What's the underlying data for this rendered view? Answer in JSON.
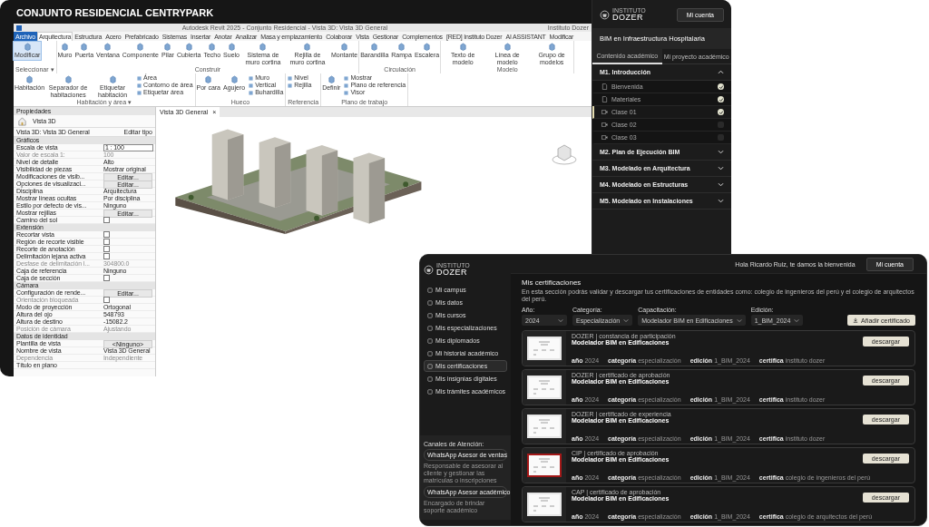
{
  "back_window": {
    "title": "CONJUNTO RESIDENCIAL CENTRYPARK",
    "revit": {
      "window_title": "Autodesk Revit 2025 - Conjunto Residencial - Vista 3D: Vista 3D General",
      "user": "Instituto Dozer",
      "tabs": [
        {
          "label": "Archivo",
          "kind": "file",
          "selected": false
        },
        {
          "label": "Arquitectura",
          "kind": "tab",
          "selected": true
        },
        {
          "label": "Estructura",
          "kind": "tab",
          "selected": false
        },
        {
          "label": "Acero",
          "kind": "tab",
          "selected": false
        },
        {
          "label": "Prefabricado",
          "kind": "tab",
          "selected": false
        },
        {
          "label": "Sistemas",
          "kind": "tab",
          "selected": false
        },
        {
          "label": "Insertar",
          "kind": "tab",
          "selected": false
        },
        {
          "label": "Anotar",
          "kind": "tab",
          "selected": false
        },
        {
          "label": "Analizar",
          "kind": "tab",
          "selected": false
        },
        {
          "label": "Masa y emplazamiento",
          "kind": "tab",
          "selected": false
        },
        {
          "label": "Colaborar",
          "kind": "tab",
          "selected": false
        },
        {
          "label": "Vista",
          "kind": "tab",
          "selected": false
        },
        {
          "label": "Gestionar",
          "kind": "tab",
          "selected": false
        },
        {
          "label": "Complementos",
          "kind": "tab",
          "selected": false
        },
        {
          "label": "[RED] Instituto Dozer",
          "kind": "tab",
          "selected": false
        },
        {
          "label": "AI ASSISTANT",
          "kind": "tab",
          "selected": false
        },
        {
          "label": "Modificar",
          "kind": "tab",
          "selected": false
        }
      ],
      "groups": [
        {
          "label": "Seleccionar ▾",
          "tools": [
            {
              "label": "Modificar",
              "kind": "large",
              "selected": true
            }
          ]
        },
        {
          "label": "Construir",
          "tools": [
            {
              "label": "Muro",
              "kind": "large",
              "selected": false
            },
            {
              "label": "Puerta",
              "kind": "large",
              "selected": false
            },
            {
              "label": "Ventana",
              "kind": "large",
              "selected": false
            },
            {
              "label": "Componente",
              "kind": "large",
              "selected": false
            },
            {
              "label": "Pilar",
              "kind": "large",
              "selected": false
            },
            {
              "label": "Cubierta",
              "kind": "large",
              "selected": false
            },
            {
              "label": "Techo",
              "kind": "large",
              "selected": false
            },
            {
              "label": "Suelo",
              "kind": "large",
              "selected": false
            },
            {
              "label": "Sistema de muro cortina",
              "kind": "large",
              "selected": false
            },
            {
              "label": "Rejilla de muro cortina",
              "kind": "large",
              "selected": false
            },
            {
              "label": "Montante",
              "kind": "large",
              "selected": false
            }
          ]
        },
        {
          "label": "Circulación",
          "tools": [
            {
              "label": "Barandilla",
              "kind": "large",
              "selected": false
            },
            {
              "label": "Rampa",
              "kind": "large",
              "selected": false
            },
            {
              "label": "Escalera",
              "kind": "large",
              "selected": false
            }
          ]
        },
        {
          "label": "Modelo",
          "tools": [
            {
              "label": "Texto de modelo",
              "kind": "large",
              "selected": false
            },
            {
              "label": "Línea de modelo",
              "kind": "large",
              "selected": false
            },
            {
              "label": "Grupo de modelos",
              "kind": "large",
              "selected": false
            }
          ]
        },
        {
          "label": "Habitación y área ▾",
          "tools": [
            {
              "label": "Habitación",
              "kind": "large",
              "selected": false
            },
            {
              "label": "Separador de habitaciones",
              "kind": "large",
              "selected": false
            },
            {
              "label": "Etiquetar habitación",
              "kind": "large",
              "selected": false
            },
            {
              "label": "Área",
              "kind": "small",
              "selected": false
            },
            {
              "label": "Contorno de área",
              "kind": "small",
              "selected": false
            },
            {
              "label": "Etiquetar área",
              "kind": "small",
              "selected": false
            }
          ]
        },
        {
          "label": "Hueco",
          "tools": [
            {
              "label": "Por cara",
              "kind": "large",
              "selected": false
            },
            {
              "label": "Agujero",
              "kind": "large",
              "selected": false
            },
            {
              "label": "Muro",
              "kind": "small",
              "selected": false
            },
            {
              "label": "Vertical",
              "kind": "small",
              "selected": false
            },
            {
              "label": "Buhardilla",
              "kind": "small",
              "selected": false
            }
          ]
        },
        {
          "label": "Referencia",
          "tools": [
            {
              "label": "Nivel",
              "kind": "small",
              "selected": false
            },
            {
              "label": "Rejilla",
              "kind": "small",
              "selected": false
            }
          ]
        },
        {
          "label": "Plano de trabajo",
          "tools": [
            {
              "label": "Definir",
              "kind": "large",
              "selected": false
            },
            {
              "label": "Mostrar",
              "kind": "small",
              "selected": false
            },
            {
              "label": "Plano de referencia",
              "kind": "small",
              "selected": false
            },
            {
              "label": "Visor",
              "kind": "small",
              "selected": false
            }
          ]
        }
      ],
      "properties": {
        "title": "Propiedades",
        "type": "Vista 3D",
        "view_selector": "Vista 3D: Vista 3D General",
        "edit_type": "Editar tipo",
        "sections": [
          {
            "title": "Gráficos",
            "rows": [
              {
                "label": "Escala de vista",
                "kind": "field",
                "value": "1 : 100",
                "disabled": false
              },
              {
                "label": "Valor de escala 1:",
                "kind": "text",
                "value": "100",
                "disabled": true
              },
              {
                "label": "Nivel de detalle",
                "kind": "text",
                "value": "Alto",
                "disabled": false
              },
              {
                "label": "Visibilidad de piezas",
                "kind": "text",
                "value": "Mostrar original",
                "disabled": false
              },
              {
                "label": "Modificaciones de visib...",
                "kind": "button",
                "value": "Editar...",
                "disabled": false
              },
              {
                "label": "Opciones de visualizaci...",
                "kind": "button",
                "value": "Editar...",
                "disabled": false
              },
              {
                "label": "Disciplina",
                "kind": "text",
                "value": "Arquitectura",
                "disabled": false
              },
              {
                "label": "Mostrar líneas ocultas",
                "kind": "text",
                "value": "Por disciplina",
                "disabled": false
              },
              {
                "label": "Estilo por defecto de vis...",
                "kind": "text",
                "value": "Ninguno",
                "disabled": false
              },
              {
                "label": "Mostrar rejillas",
                "kind": "button",
                "value": "Editar...",
                "disabled": false
              },
              {
                "label": "Camino del sol",
                "kind": "check",
                "checked": false,
                "disabled": false
              }
            ]
          },
          {
            "title": "Extensión",
            "rows": [
              {
                "label": "Recortar vista",
                "kind": "check",
                "checked": false,
                "disabled": false
              },
              {
                "label": "Región de recorte visible",
                "kind": "check",
                "checked": false,
                "disabled": false
              },
              {
                "label": "Recorte de anotación",
                "kind": "check",
                "checked": false,
                "disabled": false
              },
              {
                "label": "Delimitación lejana activa",
                "kind": "check",
                "checked": false,
                "disabled": false
              },
              {
                "label": "Desfase de delimitación l...",
                "kind": "text",
                "value": "304800.0",
                "disabled": true
              },
              {
                "label": "Caja de referencia",
                "kind": "text",
                "value": "Ninguno",
                "disabled": false
              },
              {
                "label": "Caja de sección",
                "kind": "check",
                "checked": false,
                "disabled": false
              }
            ]
          },
          {
            "title": "Cámara",
            "rows": [
              {
                "label": "Configuración de rende...",
                "kind": "button",
                "value": "Editar...",
                "disabled": false
              },
              {
                "label": "Orientación bloqueada",
                "kind": "check",
                "checked": false,
                "disabled": true
              },
              {
                "label": "Modo de proyección",
                "kind": "text",
                "value": "Ortogonal",
                "disabled": false
              },
              {
                "label": "Altura del ojo",
                "kind": "text",
                "value": "548793",
                "disabled": false
              },
              {
                "label": "Altura de destino",
                "kind": "text",
                "value": "-15082.2",
                "disabled": false
              },
              {
                "label": "Posición de cámara",
                "kind": "text",
                "value": "Ajustando",
                "disabled": true
              }
            ]
          },
          {
            "title": "Datos de identidad",
            "rows": [
              {
                "label": "Plantilla de vista",
                "kind": "button",
                "value": "<Ninguno>",
                "disabled": false
              },
              {
                "label": "Nombre de vista",
                "kind": "text",
                "value": "Vista 3D General",
                "disabled": false
              },
              {
                "label": "Dependencia",
                "kind": "text",
                "value": "Independiente",
                "disabled": true
              },
              {
                "label": "Título en plano",
                "kind": "text",
                "disabled": false
              }
            ]
          }
        ]
      },
      "view_tab": {
        "label": "Vista 3D General",
        "close": "×"
      }
    },
    "course_panel": {
      "account_button": "Mi cuenta",
      "logo_small": "INSTITUTO",
      "logo": "DOZER",
      "course_title": "BIM en Infraestructura Hospitalaria",
      "tabs": [
        {
          "label": "Contenido académico",
          "selected": true
        },
        {
          "label": "Mi proyecto académico",
          "selected": false
        }
      ],
      "modules": [
        {
          "title": "M1. Introducción",
          "expanded": true,
          "lessons": [
            {
              "label": "Bienvenida",
              "kind": "document",
              "checked": true,
              "selected": false
            },
            {
              "label": "Materiales",
              "kind": "document",
              "checked": true,
              "selected": false
            },
            {
              "label": "Clase 01",
              "kind": "video",
              "checked": true,
              "selected": true
            },
            {
              "label": "Clase 02",
              "kind": "video",
              "checked": false,
              "selected": false
            },
            {
              "label": "Clase 03",
              "kind": "video",
              "checked": false,
              "selected": false
            }
          ]
        },
        {
          "title": "M2. Plan de Ejecución BIM",
          "expanded": false
        },
        {
          "title": "M3. Modelado en Arquitectura",
          "expanded": false
        },
        {
          "title": "M4. Modelado en Estructuras",
          "expanded": false
        },
        {
          "title": "M5. Modelado en Instalaciones",
          "expanded": false
        }
      ]
    }
  },
  "front_window": {
    "logo_small": "INSTITUTO",
    "logo": "DOZER",
    "greeting": "Hola Ricardo Ruiz, te damos la bienvenida",
    "account_button": "Mi cuenta",
    "nav": [
      {
        "label": "Mi campus",
        "selected": false
      },
      {
        "label": "Mis datos",
        "selected": false
      },
      {
        "label": "Mis cursos",
        "selected": false
      },
      {
        "label": "Mis especializaciones",
        "selected": false
      },
      {
        "label": "Mis diplomados",
        "selected": false
      },
      {
        "label": "Mi historial académico",
        "selected": false
      },
      {
        "label": "Mis certificaciones",
        "selected": true
      },
      {
        "label": "Mis insignias digitales",
        "selected": false
      },
      {
        "label": "Mis trámites académicos",
        "selected": false
      }
    ],
    "channels": {
      "title": "Canales de Atención:",
      "items": [
        {
          "label": "WhatsApp Asesor de ventas",
          "note": "Responsable de asesorar al cliente y gestionar las matrículas o inscripciones"
        },
        {
          "label": "WhatsApp Asesor académico",
          "note": "Encargado de brindar soporte académico"
        }
      ]
    },
    "heading": "Mis certificaciones",
    "intro": "En esta sección podrás validar y descargar tus certificaciones de entidades como: colegio de ingenieros del perú y el colegio de arquitectos del perú.",
    "filters": [
      {
        "label": "Año:",
        "value": "2024"
      },
      {
        "label": "Categoría:",
        "value": "Especialización"
      },
      {
        "label": "Capacitación:",
        "value": "Modelador BIM en Edificaciones"
      },
      {
        "label": "Edición:",
        "value": "1_BIM_2024"
      }
    ],
    "add_button": "Añadir certificado",
    "certificates": [
      {
        "type": "DOZER | constancia de participación",
        "title": "Modelador BIM en Edificaciones",
        "color": "#e6e6e6",
        "meta": [
          [
            "año",
            "2024"
          ],
          [
            "categoría",
            "especialización"
          ],
          [
            "edición",
            "1_BIM_2024"
          ],
          [
            "certifica",
            "instituto dozer"
          ]
        ],
        "button": "descargar"
      },
      {
        "type": "DOZER | certificado de aprobación",
        "title": "Modelador BIM en Edificaciones",
        "color": "#e6e6e6",
        "meta": [
          [
            "año",
            "2024"
          ],
          [
            "categoría",
            "especialización"
          ],
          [
            "edición",
            "1_BIM_2024"
          ],
          [
            "certifica",
            "instituto dozer"
          ]
        ],
        "button": "descargar"
      },
      {
        "type": "DOZER | certificado de experiencia",
        "title": "Modelador BIM en Edificaciones",
        "color": "#e6e6e6",
        "meta": [
          [
            "año",
            "2024"
          ],
          [
            "categoría",
            "especialización"
          ],
          [
            "edición",
            "1_BIM_2024"
          ],
          [
            "certifica",
            "instituto dozer"
          ]
        ],
        "button": "descargar"
      },
      {
        "type": "CIP | certificado de aprobación",
        "title": "Modelador BIM en Edificaciones",
        "color": "#a31818",
        "meta": [
          [
            "año",
            "2024"
          ],
          [
            "categoría",
            "especialización"
          ],
          [
            "edición",
            "1_BIM_2024"
          ],
          [
            "certifica",
            "colegio de ingenieros del perú"
          ]
        ],
        "button": "descargar"
      },
      {
        "type": "CAP | certificado de aprobación",
        "title": "Modelador BIM en Edificaciones",
        "color": "#e6e6e6",
        "meta": [
          [
            "año",
            "2024"
          ],
          [
            "categoría",
            "especialización"
          ],
          [
            "edición",
            "1_BIM_2024"
          ],
          [
            "certifica",
            "colegio de arquitectos del perú"
          ]
        ],
        "button": "descargar"
      }
    ]
  }
}
